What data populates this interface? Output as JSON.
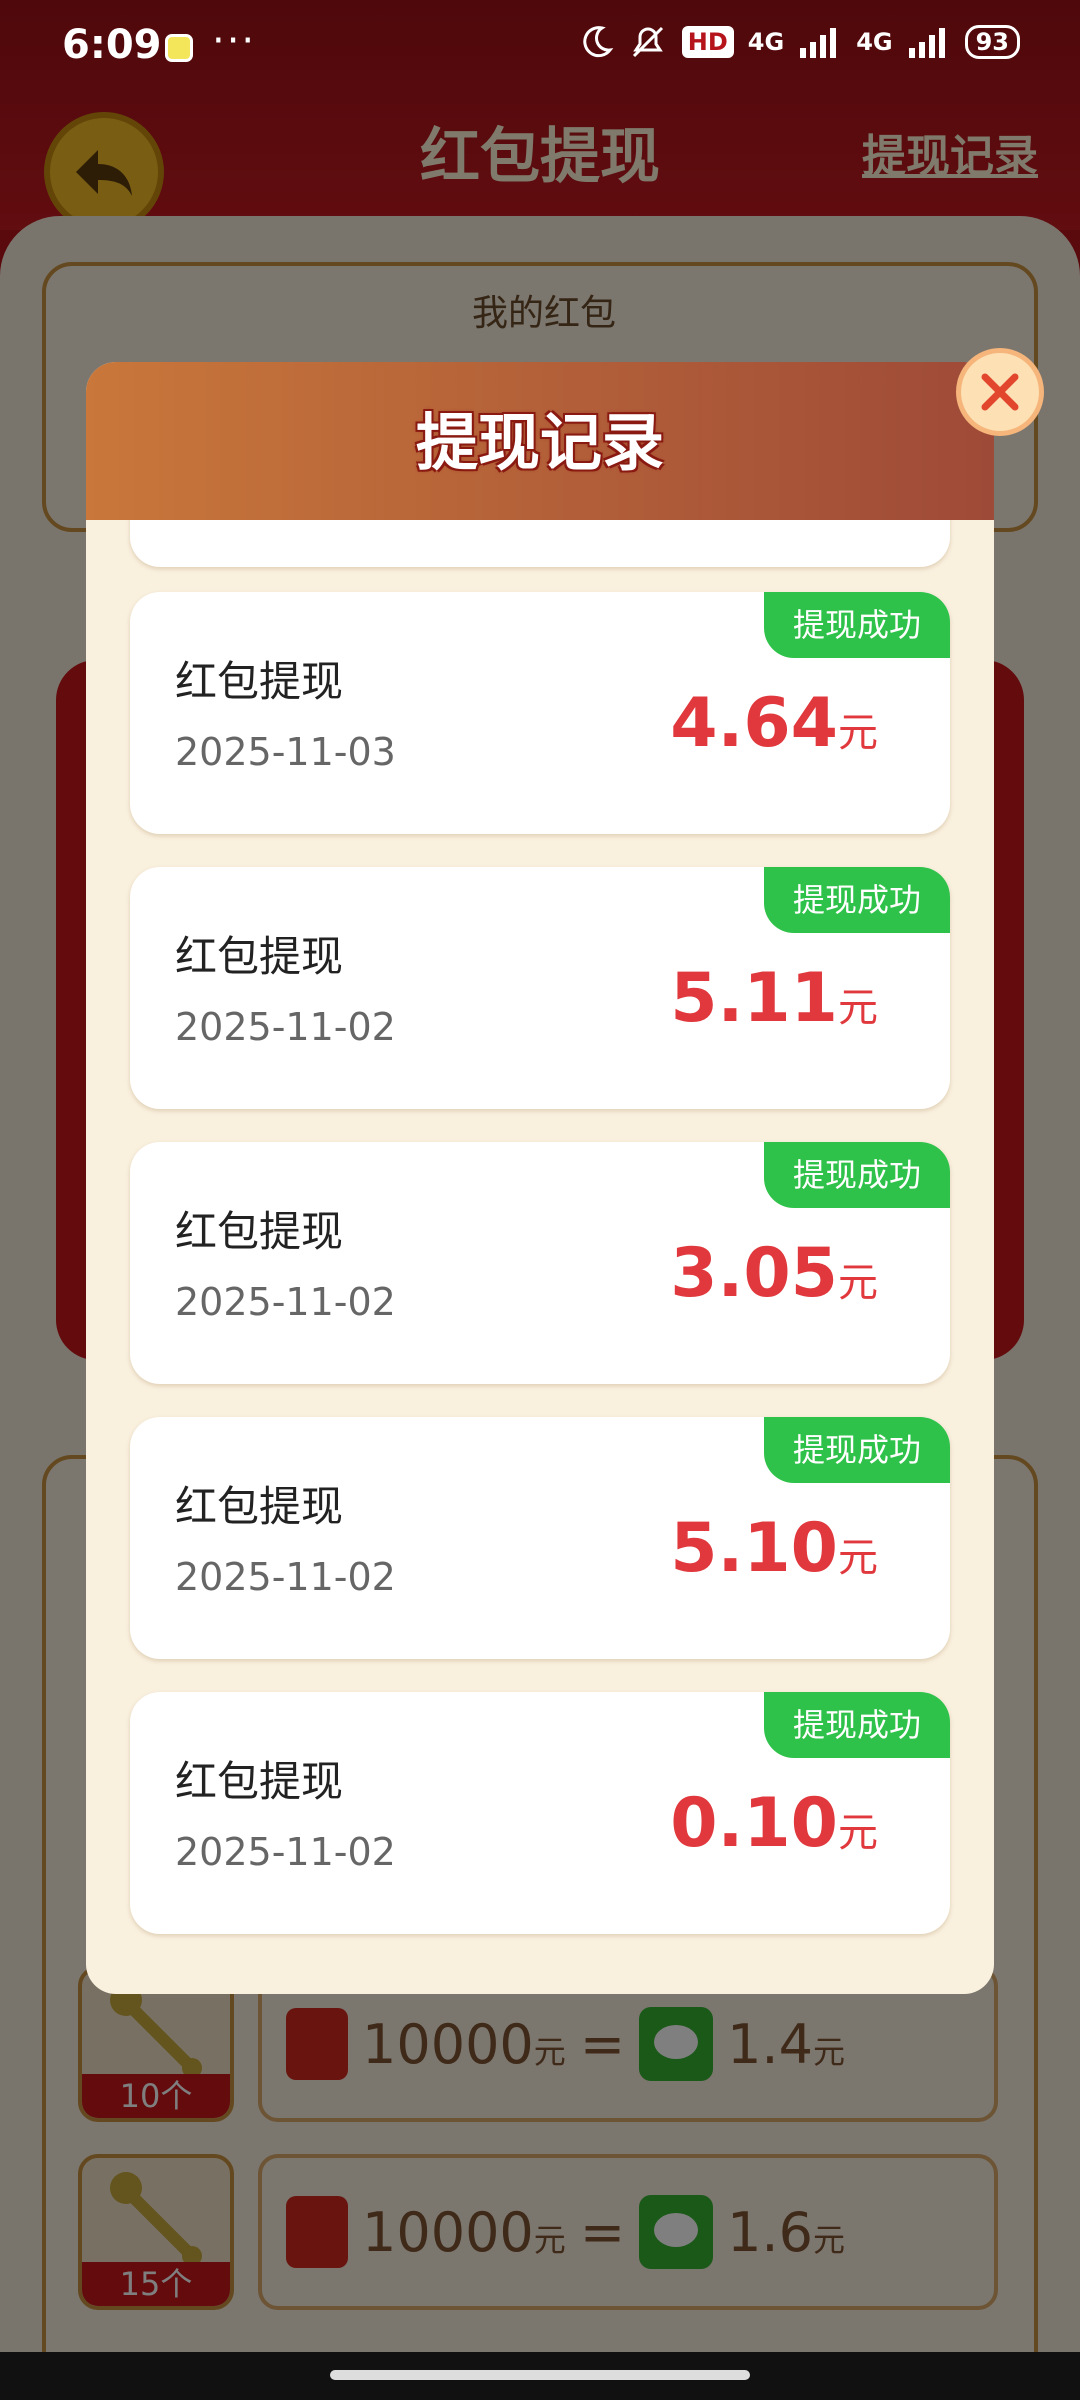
{
  "status_bar": {
    "time": "6:09",
    "dots": "···",
    "hd_label": "HD",
    "net1": "4G",
    "net2": "4G",
    "battery": "93"
  },
  "page": {
    "title": "红包提现",
    "history_link": "提现记录",
    "my_redpacket_label": "我的红包"
  },
  "exchange_rows": [
    {
      "count": "10个",
      "amount": "10000",
      "unit": "元",
      "equals": "=",
      "value": "1.4",
      "value_unit": "元"
    },
    {
      "count": "15个",
      "amount": "10000",
      "unit": "元",
      "equals": "=",
      "value": "1.6",
      "value_unit": "元"
    }
  ],
  "modal": {
    "title": "提现记录",
    "close_icon": "close-icon",
    "records": [
      {
        "name": "红包提现",
        "date": "2025-11-03",
        "status": "提现成功",
        "amount": "4.64",
        "unit": "元"
      },
      {
        "name": "红包提现",
        "date": "2025-11-02",
        "status": "提现成功",
        "amount": "5.11",
        "unit": "元"
      },
      {
        "name": "红包提现",
        "date": "2025-11-02",
        "status": "提现成功",
        "amount": "3.05",
        "unit": "元"
      },
      {
        "name": "红包提现",
        "date": "2025-11-02",
        "status": "提现成功",
        "amount": "5.10",
        "unit": "元"
      },
      {
        "name": "红包提现",
        "date": "2025-11-02",
        "status": "提现成功",
        "amount": "0.10",
        "unit": "元"
      }
    ]
  },
  "colors": {
    "accent_red": "#e0383c",
    "success_green": "#2fc24a",
    "header_brown": "#b85f39"
  }
}
